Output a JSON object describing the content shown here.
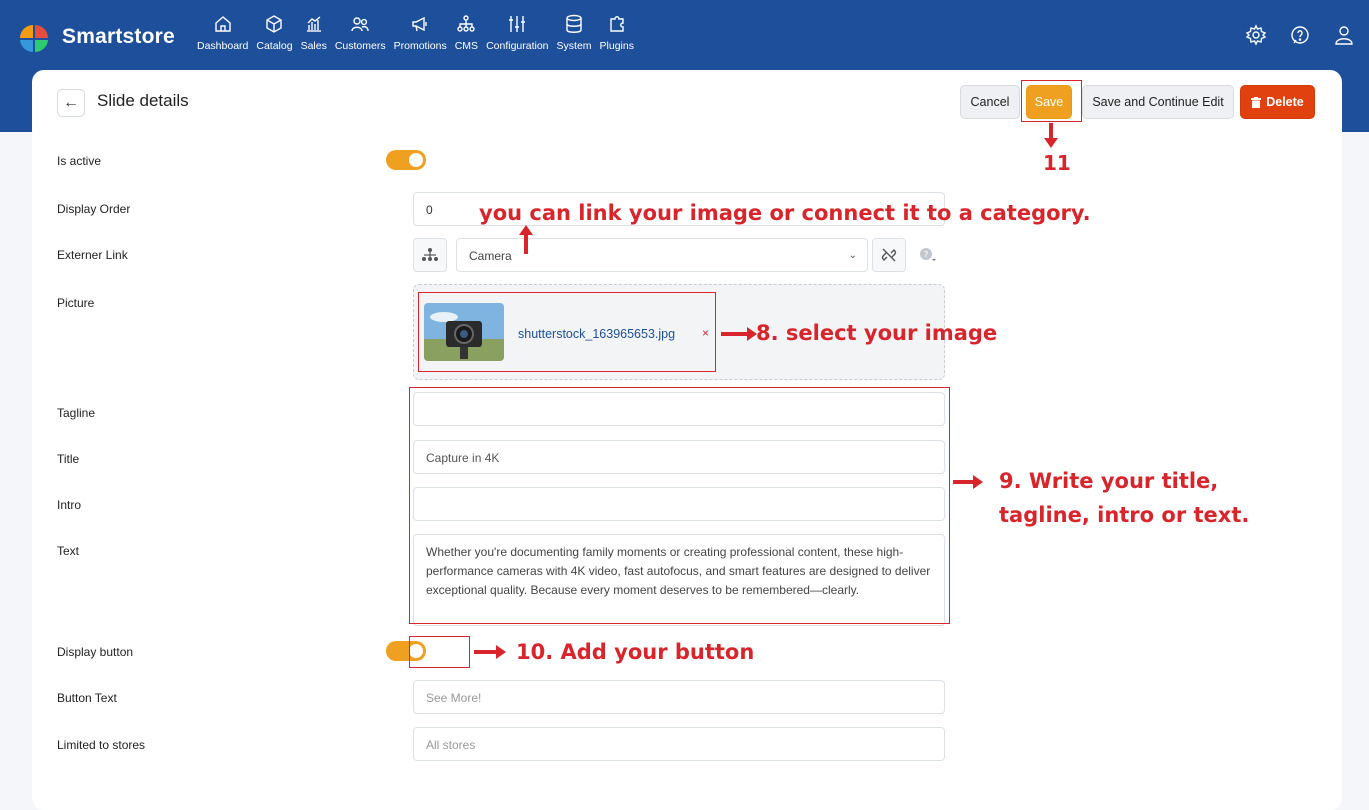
{
  "app": {
    "name": "Smartstore"
  },
  "nav": [
    {
      "label": "Dashboard",
      "icon": "home-icon"
    },
    {
      "label": "Catalog",
      "icon": "box-icon"
    },
    {
      "label": "Sales",
      "icon": "chart-icon"
    },
    {
      "label": "Customers",
      "icon": "users-icon"
    },
    {
      "label": "Promotions",
      "icon": "megaphone-icon"
    },
    {
      "label": "CMS",
      "icon": "sitemap-icon"
    },
    {
      "label": "Configuration",
      "icon": "sliders-icon"
    },
    {
      "label": "System",
      "icon": "database-icon"
    },
    {
      "label": "Plugins",
      "icon": "puzzle-icon"
    }
  ],
  "page": {
    "title": "Slide details"
  },
  "toolbar": {
    "cancel": "Cancel",
    "save": "Save",
    "save_continue": "Save and Continue Edit",
    "delete": "Delete"
  },
  "form": {
    "is_active_label": "Is active",
    "display_order_label": "Display Order",
    "display_order_value": "0",
    "extern_link_label": "Externer Link",
    "extern_link_value": "Camera",
    "picture_label": "Picture",
    "picture_file": "shutterstock_163965653.jpg",
    "picture_remove": "×",
    "tagline_label": "Tagline",
    "tagline_value": "",
    "title_label": "Title",
    "title_value": "Capture in 4K",
    "intro_label": "Intro",
    "intro_value": "",
    "text_label": "Text",
    "text_value": "Whether you're documenting family moments or creating professional content, these high-performance cameras with 4K video, fast autofocus, and smart features are designed to deliver exceptional quality. Because every moment deserves to be remembered—clearly.",
    "display_button_label": "Display button",
    "button_text_label": "Button Text",
    "button_text_placeholder": "See More!",
    "limited_stores_label": "Limited to stores",
    "limited_stores_placeholder": "All stores"
  },
  "annotations": {
    "step11": "11",
    "link_hint": "you can link your image or connect it to a category.",
    "step8": "8. select your image",
    "step9_line1": "9. Write your title,",
    "step9_line2": "tagline, intro or text.",
    "step10": "10. Add your button"
  },
  "colors": {
    "header": "#1d4f9a",
    "accent": "#f0a020",
    "danger": "#e0410f",
    "annotation": "#d8242b"
  }
}
